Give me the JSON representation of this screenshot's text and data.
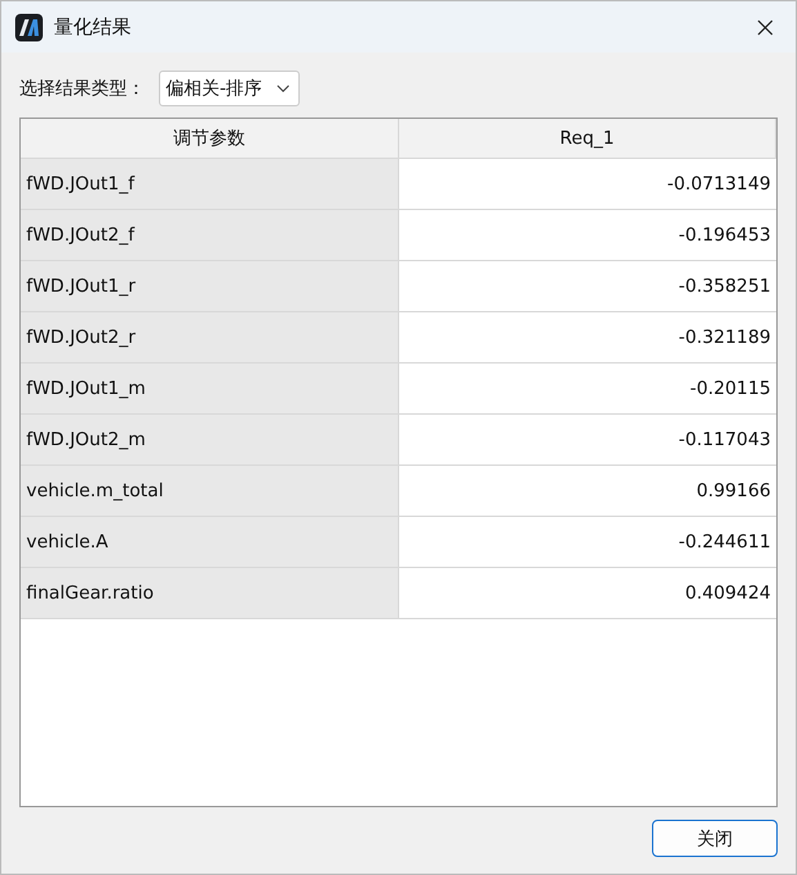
{
  "window": {
    "title": "量化结果"
  },
  "filter": {
    "label": "选择结果类型：",
    "value": "偏相关-排序"
  },
  "table": {
    "columns": [
      "调节参数",
      "Req_1"
    ],
    "rows": [
      [
        "fWD.JOut1_f",
        "-0.0713149"
      ],
      [
        "fWD.JOut2_f",
        "-0.196453"
      ],
      [
        "fWD.JOut1_r",
        "-0.358251"
      ],
      [
        "fWD.JOut2_r",
        "-0.321189"
      ],
      [
        "fWD.JOut1_m",
        "-0.20115"
      ],
      [
        "fWD.JOut2_m",
        "-0.117043"
      ],
      [
        "vehicle.m_total",
        "0.99166"
      ],
      [
        "vehicle.A",
        "-0.244611"
      ],
      [
        "finalGear.ratio",
        "0.409424"
      ]
    ]
  },
  "buttons": [
    "关闭"
  ]
}
